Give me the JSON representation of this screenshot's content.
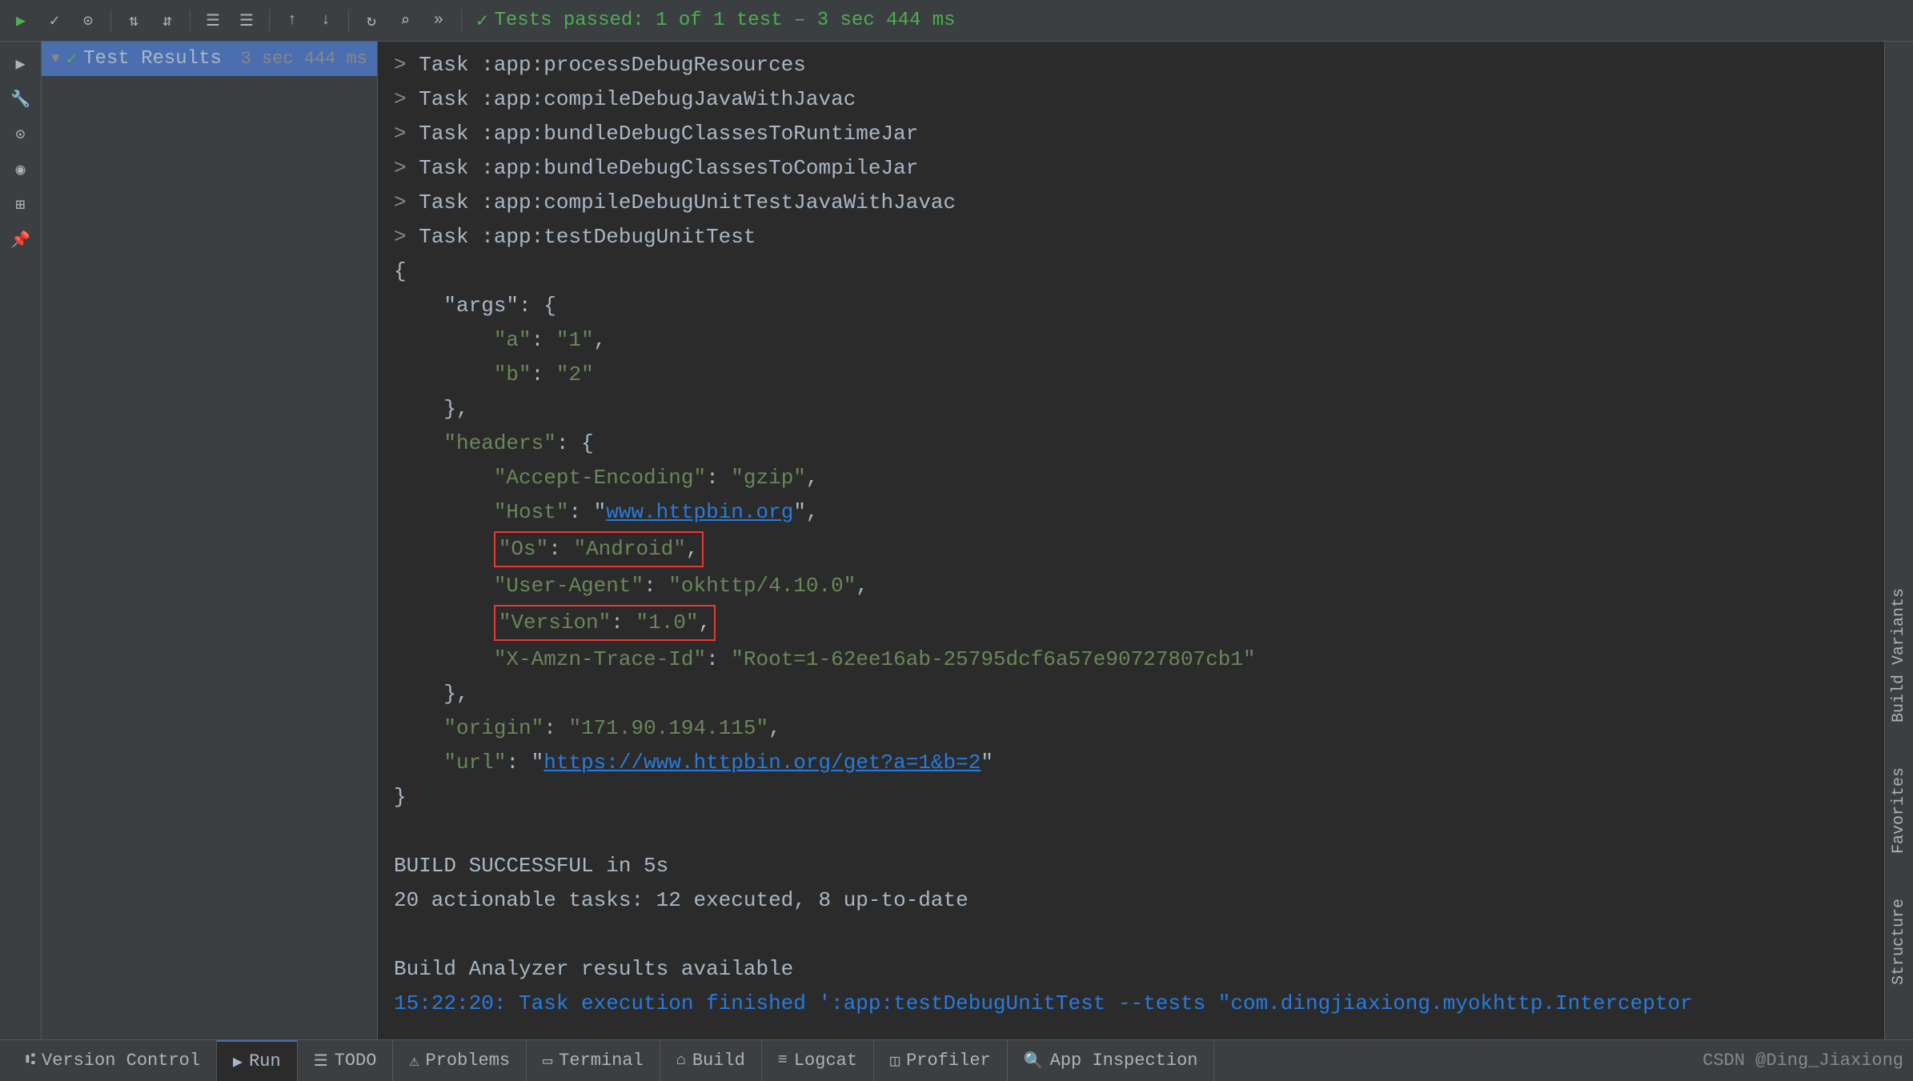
{
  "toolbar": {
    "status_text": "Tests passed: 1 of 1 test – 3 sec 444 ms",
    "status_icon": "✓",
    "buttons": [
      {
        "name": "run",
        "icon": "▶",
        "active": true
      },
      {
        "name": "check",
        "icon": "✓"
      },
      {
        "name": "stop",
        "icon": "⊙"
      },
      {
        "name": "sort-az",
        "icon": "↕"
      },
      {
        "name": "sort-za",
        "icon": "↕"
      },
      {
        "name": "align-left",
        "icon": "☰"
      },
      {
        "name": "align-both",
        "icon": "☰"
      },
      {
        "name": "up",
        "icon": "↑"
      },
      {
        "name": "down",
        "icon": "↓"
      },
      {
        "name": "refresh",
        "icon": "↻"
      },
      {
        "name": "search",
        "icon": "🔍"
      },
      {
        "name": "more",
        "icon": "»"
      }
    ]
  },
  "test_panel": {
    "row": {
      "label": "Test Results",
      "time": "3 sec 444 ms",
      "check": "✓"
    }
  },
  "output": {
    "lines": [
      {
        "type": "task",
        "text": "> Task :app:processDebugResources"
      },
      {
        "type": "task",
        "text": "> Task :app:compileDebugJavaWithJavac"
      },
      {
        "type": "task",
        "text": "> Task :app:bundleDebugClassesToRuntimeJar"
      },
      {
        "type": "task",
        "text": "> Task :app:bundleDebugClassesToCompileJar"
      },
      {
        "type": "task",
        "text": "> Task :app:compileDebugUnitTestJavaWithJavac"
      },
      {
        "type": "task",
        "text": "> Task :app:testDebugUnitTest"
      },
      {
        "type": "json",
        "text": "{"
      },
      {
        "type": "json",
        "text": "    \"args\": {"
      },
      {
        "type": "json",
        "text": "        \"a\": \"1\","
      },
      {
        "type": "json",
        "text": "        \"b\": \"2\""
      },
      {
        "type": "json",
        "text": "    },"
      },
      {
        "type": "json",
        "text": "    \"headers\": {"
      },
      {
        "type": "json",
        "text": "        \"Accept-Encoding\": \"gzip\","
      },
      {
        "type": "json-link",
        "pre": "        \"Host\": \"",
        "link": "www.httpbin.org",
        "post": "\","
      },
      {
        "type": "json-highlight",
        "text": "        \"Os\": \"Android\",",
        "highlight": true
      },
      {
        "type": "json",
        "text": "        \"User-Agent\": \"okhttp/4.10.0\","
      },
      {
        "type": "json-highlight",
        "text": "        \"Version\": \"1.0\",",
        "highlight": true
      },
      {
        "type": "json",
        "text": "        \"X-Amzn-Trace-Id\": \"Root=1-62ee16ab-25795dcf6a57e90727807cb1\""
      },
      {
        "type": "json",
        "text": "    },"
      },
      {
        "type": "json",
        "text": "    \"origin\": \"171.90.194.115\","
      },
      {
        "type": "json-link2",
        "pre": "    \"url\": \"",
        "link": "https://www.httpbin.org/get?a=1&b=2",
        "post": "\""
      },
      {
        "type": "json",
        "text": "}"
      },
      {
        "type": "empty",
        "text": ""
      },
      {
        "type": "build",
        "text": "BUILD SUCCESSFUL in 5s"
      },
      {
        "type": "build",
        "text": "20 actionable tasks: 12 executed, 8 up-to-date"
      },
      {
        "type": "empty",
        "text": ""
      },
      {
        "type": "build",
        "text": "Build Analyzer results available"
      },
      {
        "type": "timestamp",
        "text": "15:22:20: Task execution finished ':app:testDebugUnitTest --tests \"com.dingjiaxiong.myokhttp.Interceptor"
      }
    ]
  },
  "sidebar": {
    "icons": [
      "▶",
      "🔧",
      "⊙",
      "👁",
      "⊞",
      "📌"
    ]
  },
  "right_labels": [
    "Build Variants",
    "Favorites",
    "Structure"
  ],
  "bottom_tabs": [
    {
      "name": "version-control",
      "icon": "⑆",
      "label": "Version Control"
    },
    {
      "name": "run",
      "icon": "▶",
      "label": "Run",
      "active": true
    },
    {
      "name": "todo",
      "icon": "☰",
      "label": "TODO"
    },
    {
      "name": "problems",
      "icon": "⚠",
      "label": "Problems"
    },
    {
      "name": "terminal",
      "icon": "▭",
      "label": "Terminal"
    },
    {
      "name": "build",
      "icon": "☰",
      "label": "Build"
    },
    {
      "name": "logcat",
      "icon": "≡",
      "label": "Logcat"
    },
    {
      "name": "profiler",
      "icon": "📊",
      "label": "Profiler"
    },
    {
      "name": "app-inspection",
      "icon": "🔍",
      "label": "App Inspection"
    }
  ],
  "csdn_label": "CSDN @Ding_Jiaxiong"
}
